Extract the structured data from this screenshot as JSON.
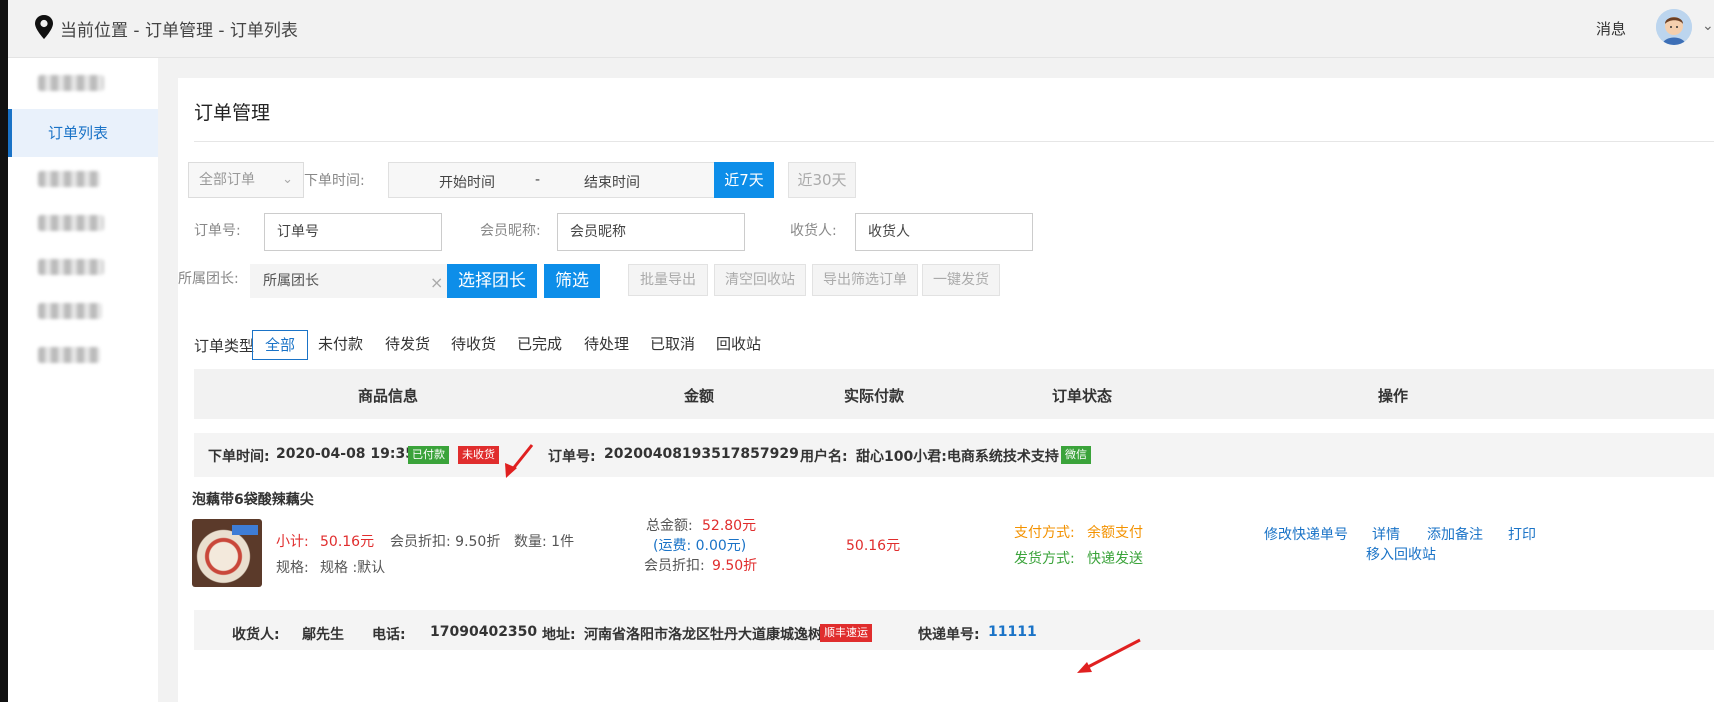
{
  "header": {
    "breadcrumb": "当前位置 - 订单管理 - 订单列表",
    "messages_label": "消息"
  },
  "sidebar": {
    "active_item": "订单列表"
  },
  "main": {
    "title": "订单管理",
    "filters": {
      "order_scope": "全部订单",
      "time_label": "下单时间:",
      "start_placeholder": "开始时间",
      "range_separator": "-",
      "end_placeholder": "结束时间",
      "btn_7days": "近7天",
      "btn_30days": "近30天",
      "order_no_label": "订单号:",
      "order_no_placeholder": "订单号",
      "member_label": "会员昵称:",
      "member_placeholder": "会员昵称",
      "receiver_label": "收货人:",
      "receiver_placeholder": "收货人",
      "leader_label": "所属团长:",
      "leader_placeholder": "所属团长",
      "clear_symbol": "×",
      "btn_choose_leader": "选择团长",
      "btn_filter": "筛选",
      "btn_batch_export": "批量导出",
      "btn_clear_recycle": "清空回收站",
      "btn_export_filtered": "导出筛选订单",
      "btn_one_click_ship": "一键发货"
    },
    "tabs_label": "订单类型",
    "tabs": [
      "全部",
      "未付款",
      "待发货",
      "待收货",
      "已完成",
      "待处理",
      "已取消",
      "回收站"
    ],
    "table_headers": {
      "product": "商品信息",
      "amount": "金额",
      "paid": "实际付款",
      "status": "订单状态",
      "actions": "操作"
    },
    "order": {
      "time_label": "下单时间:",
      "time": "2020-04-08 19:35:17",
      "paid_badge": "已付款",
      "unreceived_badge": "未收货",
      "order_no_label": "订单号:",
      "order_no": "20200408193517857929",
      "user_label": "用户名:",
      "user": "甜心100小君:电商系统技术支持",
      "channel_badge": "微信",
      "product_name": "泡藕带6袋酸辣藕尖",
      "subtotal_label": "小计:",
      "subtotal": "50.16元",
      "member_discount": "会员折扣: 9.50折",
      "quantity": "数量: 1件",
      "spec_label": "规格:",
      "spec_value": "规格 :默认",
      "total_label": "总金额:",
      "total": "52.80元",
      "shipping": "(运费: 0.00元)",
      "discount_label": "会员折扣:",
      "discount": "9.50折",
      "actual_paid": "50.16元",
      "pay_method_label": "支付方式:",
      "pay_method": "余额支付",
      "ship_method_label": "发货方式:",
      "ship_method": "快递发送",
      "actions": [
        "修改快递单号",
        "详情",
        "添加备注",
        "打印",
        "移入回收站"
      ],
      "receiver_label": "收货人:",
      "receiver": "鄔先生",
      "phone_label": "电话:",
      "phone": "17090402350",
      "address_label": "地址:",
      "address": "河南省洛阳市洛龙区牡丹大道康城逸树",
      "courier_badge": "顺丰速运",
      "tracking_label": "快递单号:",
      "tracking_no": "11111"
    }
  },
  "colors": {
    "primary": "#0d8ee9",
    "link": "#1a73c7",
    "price_red": "#e02d2d",
    "paid_badge": "#3aa33a",
    "unreceived_badge": "#e02d2d",
    "annotation_arrow": "#e02020"
  }
}
